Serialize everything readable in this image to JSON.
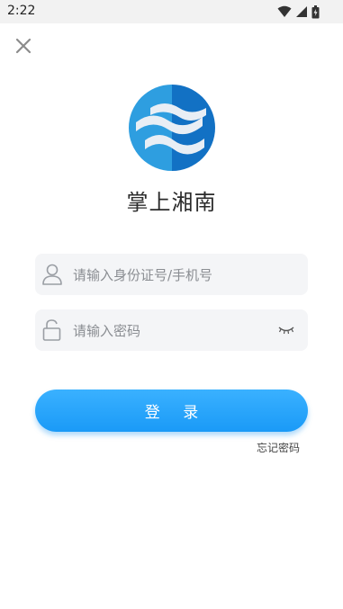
{
  "status_bar": {
    "time": "2:22",
    "icons": [
      "wifi-icon",
      "signal-icon",
      "battery-icon"
    ]
  },
  "app": {
    "name": "掌上湘南",
    "logo": "wave-logo"
  },
  "form": {
    "account_placeholder": "请输入身份证号/手机号",
    "password_placeholder": "请输入密码",
    "login_label": "登 录",
    "forgot_label": "忘记密码"
  },
  "colors": {
    "accent": "#1fa2ff",
    "logo_light": "#2e9ee0",
    "logo_dark": "#1271c4"
  }
}
